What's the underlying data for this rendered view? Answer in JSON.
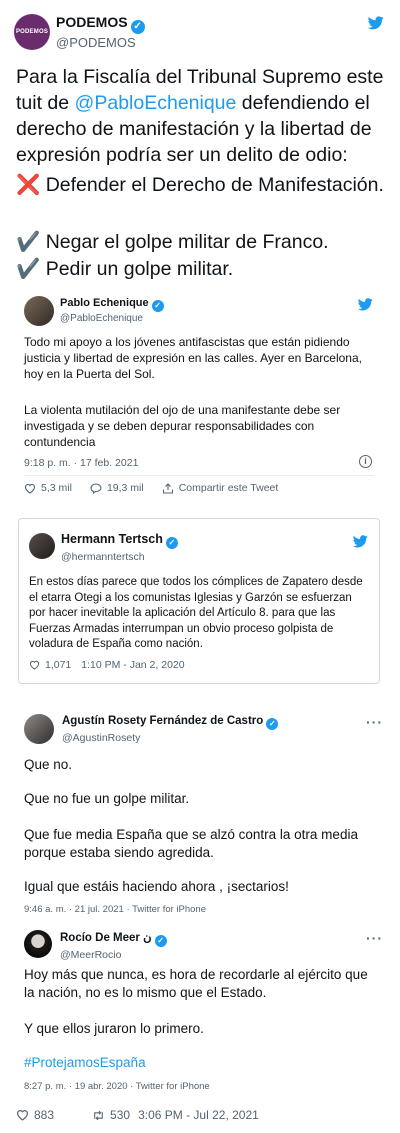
{
  "main": {
    "avatar_text": "PODEMOS",
    "name": "PODEMOS",
    "handle": "@PODEMOS",
    "body_before": "Para la Fiscalía del Tribunal Supremo este tuit de ",
    "body_mention": "@PabloEchenique",
    "body_after": " defendiendo el derecho de manifestación y la libertad de expresión podría ser un delito de odio:",
    "line_x": "❌ Defender el Derecho de Manifestación.",
    "line_check1": "✔️ Negar el golpe militar de Franco.",
    "line_check2": "✔️ Pedir un golpe militar.",
    "likes": "883",
    "retweets": "530",
    "timestamp": "3:06 PM - Jul 22, 2021"
  },
  "quote1": {
    "name": "Pablo Echenique",
    "handle": "@PabloEchenique",
    "p1": "Todo mi apoyo a los jóvenes antifascistas que están pidiendo justicia y libertad de expresión en las calles. Ayer en Barcelona, hoy en la Puerta del Sol.",
    "p2": "La violenta mutilación del ojo de una manifestante debe ser investigada y se deben depurar responsabilidades con contundencia",
    "timestamp": "9:18 p. m. · 17 feb. 2021",
    "likes": "5,3 mil",
    "replies": "19,3 mil",
    "share": "Compartir este Tweet"
  },
  "quote2": {
    "name": "Hermann Tertsch",
    "handle": "@hermanntertsch",
    "body": "En estos días parece que todos los cómplices de Zapatero desde el etarra Otegi a los comunistas Iglesias y Garzón se esfuerzan por hacer inevitable la aplicación del Artículo 8. para que las Fuerzas Armadas interrumpan un obvio proceso golpista de voladura de España como nación.",
    "likes": "1,071",
    "timestamp": "1:10 PM - Jan 2, 2020"
  },
  "quote3": {
    "name": "Agustín Rosety Fernández de Castro",
    "handle": "@AgustinRosety",
    "p1": "Que no.",
    "p2": "Que no fue un golpe militar.",
    "p3": "Que fue media España que se alzó contra la otra media porque estaba siendo agredida.",
    "p4": "Igual que estáis haciendo ahora , ¡sectarios!",
    "meta": "9:46 a. m. · 21 jul. 2021 · Twitter for iPhone"
  },
  "quote4": {
    "name": "Rocío De Meer",
    "name_suffix": "ن",
    "handle": "@MeerRocio",
    "p1": "Hoy más que nunca, es hora de recordarle al ejército que la nación, no es lo mismo que el Estado.",
    "p2": "Y que ellos juraron lo primero.",
    "hashtag": "#ProtejamosEspaña",
    "meta": "8:27 p. m. · 19 abr. 2020 · Twitter for iPhone"
  },
  "colors": {
    "twitter_blue": "#1d9bf0",
    "podemos_purple": "#6b2c6e",
    "text": "#0f1419",
    "muted": "#536471"
  },
  "icons": [
    "twitter-bird-icon",
    "verified-badge-icon",
    "heart-icon",
    "retweet-icon",
    "reply-icon",
    "share-icon",
    "more-dots-icon",
    "info-icon"
  ]
}
